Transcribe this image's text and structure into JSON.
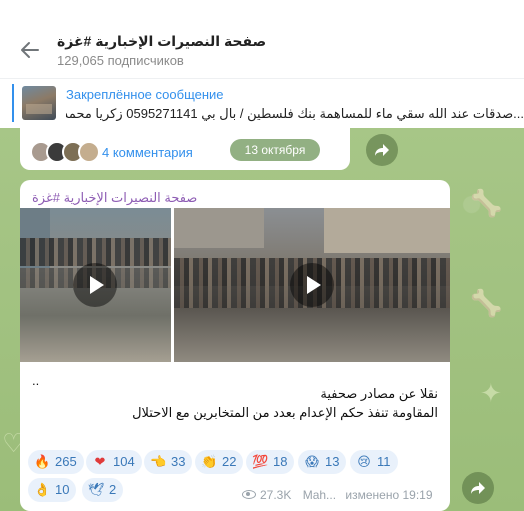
{
  "header": {
    "title": "صفحة النصيرات الإخبارية #غزة",
    "subscribers": "129,065 подписчиков"
  },
  "pinned": {
    "label": "Закреплённое сообщение",
    "text": "...صدقات عند الله سقي ماء  للمساهمة بنك فلسطين / بال بي 0595271141 زكريا محمد  اي با"
  },
  "prev_post": {
    "comments": "4 комментария",
    "date": "13 октября"
  },
  "post": {
    "author": "صفحة النصيرات الإخبارية #غزة",
    "ellipsis": "..",
    "caption_line1": "نقلا عن مصادر صحفية",
    "caption_line2": "المقاومة تنفذ حكم الإعدام بعدد من المتخابرين مع الاحتلال",
    "reactions": [
      {
        "emoji": "🔥",
        "count": "265"
      },
      {
        "emoji": "❤",
        "count": "104"
      },
      {
        "emoji": "👈",
        "count": "33"
      },
      {
        "emoji": "👏",
        "count": "22"
      },
      {
        "emoji": "💯",
        "count": "18"
      },
      {
        "emoji": "😱",
        "count": "13"
      },
      {
        "emoji": "😢",
        "count": "11"
      },
      {
        "emoji": "👌",
        "count": "10"
      },
      {
        "emoji": "🕊",
        "count": "2"
      }
    ],
    "views": "27.3K",
    "author_short": "Mah...",
    "edited_time": "изменено 19:19"
  },
  "icons": {
    "back": "arrow-left-icon",
    "forward": "share-arrow-icon",
    "play": "play-icon",
    "views": "eye-icon"
  },
  "colors": {
    "accent": "#3390ec",
    "author": "#8e5db4",
    "chat_bg": "#9fbf7d"
  }
}
